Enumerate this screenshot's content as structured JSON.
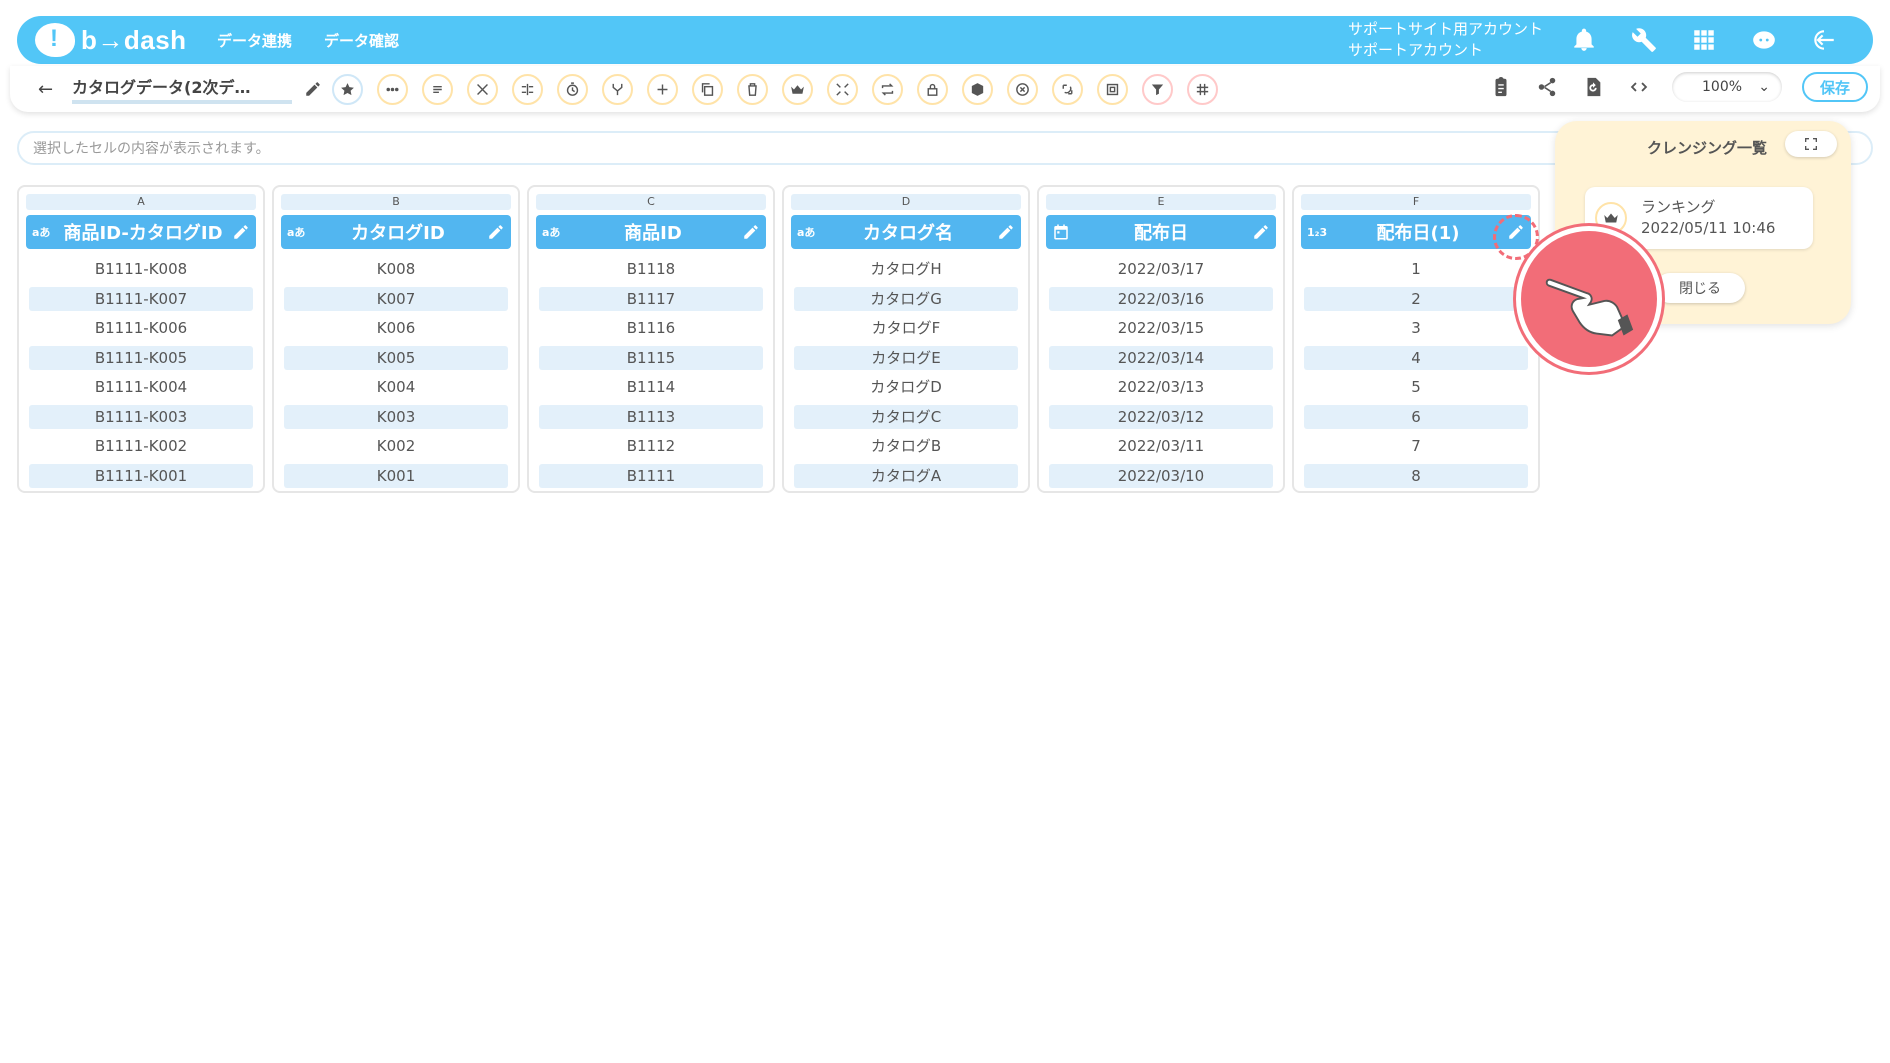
{
  "header": {
    "logo_text": "b→dash",
    "nav": [
      "データ連携",
      "データ確認"
    ],
    "account_line1": "サポートサイト用アカウント",
    "account_line2": "サポートアカウント"
  },
  "toolbar": {
    "back_icon": "←",
    "doc_title": "カタログデータ(2次デ…",
    "zoom_value": "100%",
    "save_label": "保存"
  },
  "cellbar": {
    "placeholder": "選択したセルの内容が表示されます。"
  },
  "columns": [
    {
      "letter": "A",
      "type": "aあ",
      "name": "商品ID-カタログID",
      "values": [
        "B1111-K008",
        "B1111-K007",
        "B1111-K006",
        "B1111-K005",
        "B1111-K004",
        "B1111-K003",
        "B1111-K002",
        "B1111-K001"
      ]
    },
    {
      "letter": "B",
      "type": "aあ",
      "name": "カタログID",
      "values": [
        "K008",
        "K007",
        "K006",
        "K005",
        "K004",
        "K003",
        "K002",
        "K001"
      ]
    },
    {
      "letter": "C",
      "type": "aあ",
      "name": "商品ID",
      "values": [
        "B1118",
        "B1117",
        "B1116",
        "B1115",
        "B1114",
        "B1113",
        "B1112",
        "B1111"
      ]
    },
    {
      "letter": "D",
      "type": "aあ",
      "name": "カタログ名",
      "values": [
        "カタログH",
        "カタログG",
        "カタログF",
        "カタログE",
        "カタログD",
        "カタログC",
        "カタログB",
        "カタログA"
      ]
    },
    {
      "letter": "E",
      "type": "calendar",
      "name": "配布日",
      "values": [
        "2022/03/17",
        "2022/03/16",
        "2022/03/15",
        "2022/03/14",
        "2022/03/13",
        "2022/03/12",
        "2022/03/11",
        "2022/03/10"
      ]
    },
    {
      "letter": "F",
      "type": "1₂3",
      "name": "配布日(1)",
      "values": [
        "1",
        "2",
        "3",
        "4",
        "5",
        "6",
        "7",
        "8"
      ]
    }
  ],
  "panel": {
    "title": "クレンジング一覧",
    "card_name": "ランキング",
    "card_date": "2022/05/11 10:46",
    "close_label": "閉じる"
  }
}
